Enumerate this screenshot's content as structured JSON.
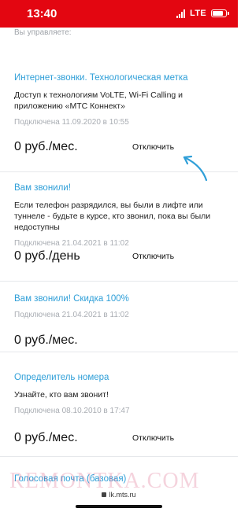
{
  "status_bar": {
    "time": "13:40",
    "network": "LTE"
  },
  "section_header": "Вы управляете:",
  "services": [
    {
      "title": "Интернет-звонки. Технологическая метка",
      "description": "Доступ к технологиям VoLTE, Wi-Fi Calling и приложению «МТС Коннект»",
      "date": "Подключена 11.09.2020 в 10:55",
      "price": "0 руб./мес.",
      "action": "Отключить"
    },
    {
      "title": "Вам звонили!",
      "description": "Если телефон разрядился, вы были в лифте или туннеле - будьте в курсе, кто звонил, пока вы были недоступны",
      "date": "Подключена 21.04.2021 в 11:02",
      "price": "0 руб./день",
      "action": "Отключить"
    },
    {
      "title": "Вам звонили! Скидка 100%",
      "description": "",
      "date": "Подключена 21.04.2021 в 11:02",
      "price": "0 руб./мес.",
      "action": ""
    },
    {
      "title": "Определитель номера",
      "description": "Узнайте, кто вам звонит!",
      "date": "Подключена 08.10.2010 в 17:47",
      "price": "0 руб./мес.",
      "action": "Отключить"
    },
    {
      "title": "Голосовая почта (базовая)"
    }
  ],
  "url_bar": "lk.mts.ru",
  "watermark": "REMONTKA.COM",
  "colors": {
    "brand_red": "#e30611",
    "link_blue": "#2f9fd8",
    "arrow": "#2f9fd8"
  }
}
